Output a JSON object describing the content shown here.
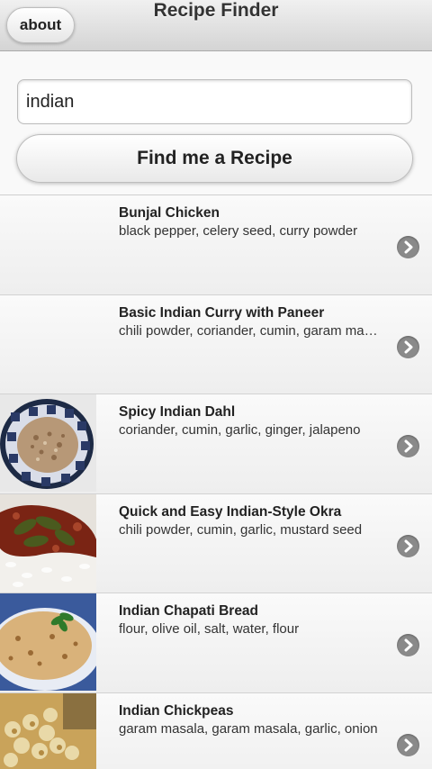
{
  "header": {
    "about_label": "about",
    "title": "Recipe Finder"
  },
  "search": {
    "value": "indian",
    "button_label": "Find me a Recipe"
  },
  "recipes": [
    {
      "name": "Bunjal Chicken",
      "ingredients": "black pepper, celery seed, curry powder",
      "has_image": false
    },
    {
      "name": "Basic Indian Curry with Paneer",
      "ingredients": "chili powder, coriander, cumin, garam masala",
      "has_image": false
    },
    {
      "name": "Spicy Indian Dahl",
      "ingredients": "coriander, cumin, garlic, ginger, jalapeno",
      "has_image": true,
      "image": "dahl-in-blue-bowl"
    },
    {
      "name": "Quick and Easy Indian-Style Okra",
      "ingredients": "chili powder, cumin, garlic, mustard seed",
      "has_image": true,
      "image": "okra-on-rice"
    },
    {
      "name": "Indian Chapati Bread",
      "ingredients": "flour, olive oil, salt, water, flour",
      "has_image": true,
      "image": "chapati-on-plate"
    },
    {
      "name": "Indian Chickpeas",
      "ingredients": "garam masala, garam masala, garlic, onion",
      "has_image": true,
      "image": "chickpeas-in-bowl"
    }
  ],
  "icons": {
    "row_arrow": "chevron-right-circle-icon"
  },
  "colors": {
    "header_bg": "#d4d4d4",
    "list_bg": "#f4f4f4",
    "arrow_bg": "#8a8a8a"
  }
}
